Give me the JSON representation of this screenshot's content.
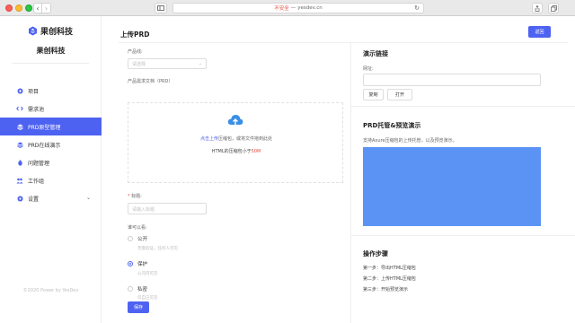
{
  "browser": {
    "url_warning": "不安全",
    "url_separator": "—",
    "url_host": "yesdev.cn"
  },
  "sidebar": {
    "logo_text": "果创科技",
    "team_name": "果创科技",
    "items": [
      {
        "label": "项目",
        "icon": "dot-icon"
      },
      {
        "label": "需求池",
        "icon": "code-icon"
      },
      {
        "label": "PRD原型管理",
        "icon": "layers-icon",
        "active": true
      },
      {
        "label": "PRD在线演示",
        "icon": "stack-icon"
      },
      {
        "label": "问题管理",
        "icon": "bug-icon"
      },
      {
        "label": "工作组",
        "icon": "team-icon"
      },
      {
        "label": "设置",
        "icon": "gear-icon",
        "has_submenu": true
      }
    ],
    "copyright": "©2020 Power by YesDev"
  },
  "main": {
    "title": "上传PRD",
    "back_label": "返回",
    "product_line_label": "产品线:",
    "product_line_placeholder": "请选择",
    "doc_label": "产品需求文档（PRD）",
    "upload": {
      "click_text": "点击上传",
      "hint_text": "压缩包，或将文件拖到此处",
      "limit_prefix": "HTML的压缩包小于",
      "limit_value": "50M"
    },
    "title_label": "标题:",
    "title_required": "*",
    "title_placeholder": "请输入标题",
    "visibility_label": "谁可以看:",
    "visibility_options": [
      {
        "label": "公开",
        "desc": "无需验证，任何人可见",
        "checked": false
      },
      {
        "label": "保护",
        "desc": "公司内可见",
        "checked": true
      },
      {
        "label": "私密",
        "desc": "仅自己可见",
        "checked": false
      }
    ],
    "save_label": "保存"
  },
  "right": {
    "demo_title": "演示链接",
    "address_label": "网址:",
    "copy_label": "复制",
    "open_label": "打开",
    "hosting_title": "PRD托管&预览演示",
    "hosting_desc": "支持Axure压缩包的上传托管，以及预览演示。",
    "preview_color": "#5b93f5",
    "steps_title": "操作步骤",
    "steps": [
      "第一步：导出HTML压缩包",
      "第二步：上传HTML压缩包",
      "第三步：开始预览演示"
    ]
  },
  "colors": {
    "accent": "#4e62f2"
  }
}
